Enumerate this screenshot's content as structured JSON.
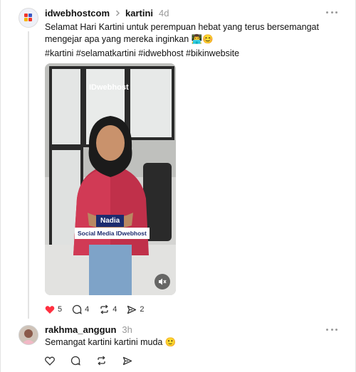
{
  "post": {
    "username": "idwebhostcom",
    "topic": "kartini",
    "time": "4d",
    "text": "Selamat Hari Kartini untuk perempuan hebat yang terus bersemangat mengejar apa yang mereka inginkan 👨‍💻😊",
    "hashtags": "#kartini #selamatkartini #idwebhost #bikinwebsite",
    "video": {
      "logo_text": "IDwebhost",
      "name_tag": "Nadia",
      "title_tag": "Social Media IDwebhost"
    },
    "stats": {
      "likes": "5",
      "comments": "4",
      "reposts": "4",
      "shares": "2"
    }
  },
  "reply": {
    "username": "rakhma_anggun",
    "time": "3h",
    "text": "Semangat kartini kartini muda 🙂"
  },
  "colors": {
    "like_red": "#ff3040",
    "muted_text": "#999999"
  },
  "icons": [
    "idwebhost-logo-icon",
    "chevron-right-icon",
    "more-icon",
    "heart-icon",
    "comment-icon",
    "repost-icon",
    "share-icon",
    "mute-icon"
  ]
}
